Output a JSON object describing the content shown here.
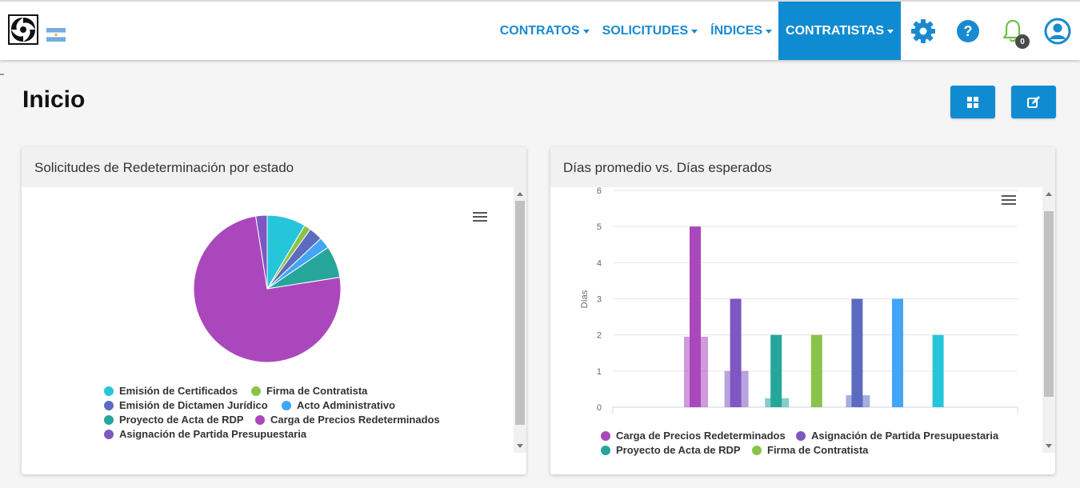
{
  "nav": {
    "items": [
      {
        "label": "CONTRATOS",
        "active": false
      },
      {
        "label": "SOLICITUDES",
        "active": false
      },
      {
        "label": "ÍNDICES",
        "active": false
      },
      {
        "label": "CONTRATISTAS",
        "active": true
      }
    ],
    "notification_count": "0",
    "icons": [
      "gear-icon",
      "help-icon",
      "bell-icon",
      "user-icon"
    ],
    "accent": "#0f8bd1"
  },
  "page": {
    "title": "Inicio",
    "buttons": [
      "grid-icon",
      "edit-icon"
    ]
  },
  "panels": {
    "pie": {
      "title": "Solicitudes de Redeterminación por estado"
    },
    "bar": {
      "title": "Días promedio vs. Días esperados"
    }
  },
  "chart_data": [
    {
      "type": "pie",
      "slices": [
        {
          "name": "Emisión de Certificados",
          "value": 8.5,
          "color": "#26c6da"
        },
        {
          "name": "Firma de Contratista",
          "value": 1.5,
          "color": "#8bc34a"
        },
        {
          "name": "Emisión de Dictamen Jurídico",
          "value": 3.0,
          "color": "#5c6bc0"
        },
        {
          "name": "Acto Administrativo",
          "value": 2.5,
          "color": "#42a5f5"
        },
        {
          "name": "Proyecto de Acta de RDP",
          "value": 7.0,
          "color": "#26a69a"
        },
        {
          "name": "Carga de Precios Redeterminados",
          "value": 75.0,
          "color": "#ab47bc"
        },
        {
          "name": "Asignación de Partida Presupuestaria",
          "value": 2.5,
          "color": "#7e57c2"
        }
      ]
    },
    {
      "type": "bar",
      "ylabel": "Días",
      "ylim": [
        0,
        6
      ],
      "yticks": [
        "0",
        "1",
        "2",
        "3",
        "4",
        "5",
        "6"
      ],
      "grid": true,
      "groups": [
        {
          "expected": 1.95,
          "average": 5,
          "color": "#ab47bc"
        },
        {
          "expected": 1.0,
          "average": 3,
          "color": "#7e57c2"
        },
        {
          "expected": 0.25,
          "average": 2,
          "color": "#26a69a"
        },
        {
          "expected": null,
          "average": 2,
          "color": "#8bc34a"
        },
        {
          "expected": 0.33,
          "average": 3,
          "color": "#5c6bc0"
        },
        {
          "expected": null,
          "average": 3,
          "color": "#42a5f5"
        },
        {
          "expected": null,
          "average": 2,
          "color": "#26c6da"
        }
      ],
      "legend": [
        {
          "name": "Carga de Precios Redeterminados",
          "color": "#ab47bc"
        },
        {
          "name": "Asignación de Partida Presupuestaria",
          "color": "#7e57c2"
        },
        {
          "name": "Proyecto de Acta de RDP",
          "color": "#26a69a"
        },
        {
          "name": "Firma de Contratista",
          "color": "#8bc34a"
        }
      ]
    }
  ]
}
